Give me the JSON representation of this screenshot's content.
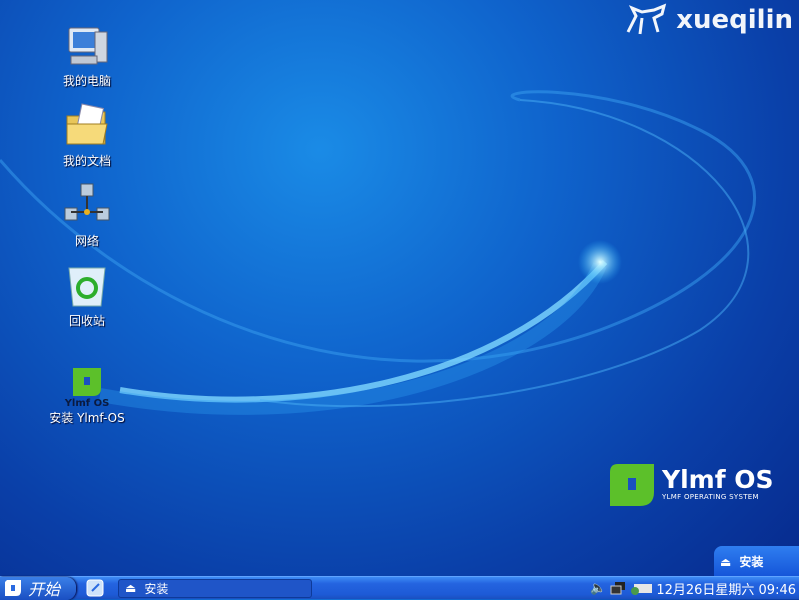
{
  "desktop": {
    "icons": [
      {
        "label": "我的电脑",
        "icon": "computer-icon"
      },
      {
        "label": "我的文档",
        "icon": "documents-folder-icon"
      },
      {
        "label": "网络",
        "icon": "network-icon"
      },
      {
        "label": "回收站",
        "icon": "recycle-bin-icon"
      },
      {
        "label": "安装 Ylmf-OS",
        "icon": "ylmf-install-icon",
        "logo_text": "Ylmf OS"
      }
    ]
  },
  "brand": {
    "text": "xueqilin"
  },
  "wallpaper_logo": {
    "title": "Ylmf OS",
    "subtitle": "YLMF OPERATING SYSTEM"
  },
  "notification": {
    "label": "安装"
  },
  "taskbar": {
    "start_label": "开始",
    "task_label": "安装",
    "clock": "12月26日星期六 09:46"
  },
  "colors": {
    "accent": "#1d5ad6",
    "logo_green": "#5cc02a"
  }
}
